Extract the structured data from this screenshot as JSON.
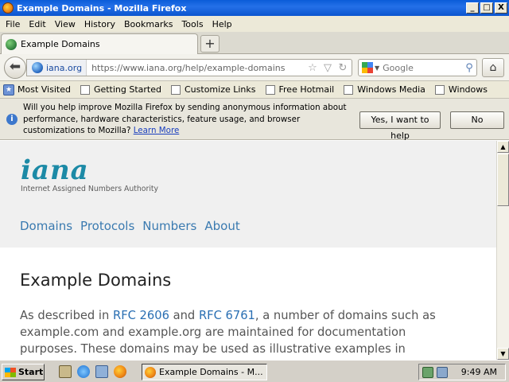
{
  "window": {
    "title": "Example Domains - Mozilla Firefox",
    "minimize": "_",
    "maximize": "□",
    "close": "X"
  },
  "menu": [
    "File",
    "Edit",
    "View",
    "History",
    "Bookmarks",
    "Tools",
    "Help"
  ],
  "tab": {
    "title": "Example Domains",
    "new_tab": "+"
  },
  "nav": {
    "domain": "iana.org",
    "url": "https://www.iana.org/help/example-domains",
    "search_placeholder": "Google"
  },
  "bookmarks": [
    "Most Visited",
    "Getting Started",
    "Customize Links",
    "Free Hotmail",
    "Windows Media",
    "Windows"
  ],
  "notification": {
    "text": "Will you help improve Mozilla Firefox by sending anonymous information about performance, hardware characteristics, feature usage, and browser customizations to Mozilla?",
    "learn_more": "Learn More",
    "yes": "Yes, I want to help",
    "no": "No"
  },
  "page": {
    "logo": "iana",
    "logo_tagline": "Internet Assigned Numbers Authority",
    "nav": [
      "Domains",
      "Protocols",
      "Numbers",
      "About"
    ],
    "heading": "Example Domains",
    "para_1": "As described in ",
    "link_1": "RFC 2606",
    "para_2": " and ",
    "link_2": "RFC 6761",
    "para_3": ", a number of domains such as example.com and example.org are maintained for documentation purposes. These domains may be used as illustrative examples in"
  },
  "taskbar": {
    "start": "Start",
    "task": "Example Domains - M...",
    "clock": "9:49 AM"
  },
  "colors": {
    "title_bar": "#0a5cd8",
    "iana_teal": "#1c8aa6",
    "nav_link": "#3a7ab0",
    "body_link": "#2a6fb3"
  },
  "icons": [
    "firefox-icon",
    "globe-icon",
    "back-arrow-icon",
    "star-icon",
    "dropmarker-icon",
    "reload-icon",
    "google-icon",
    "magnifier-icon",
    "home-icon",
    "info-icon",
    "windows-logo-icon"
  ]
}
